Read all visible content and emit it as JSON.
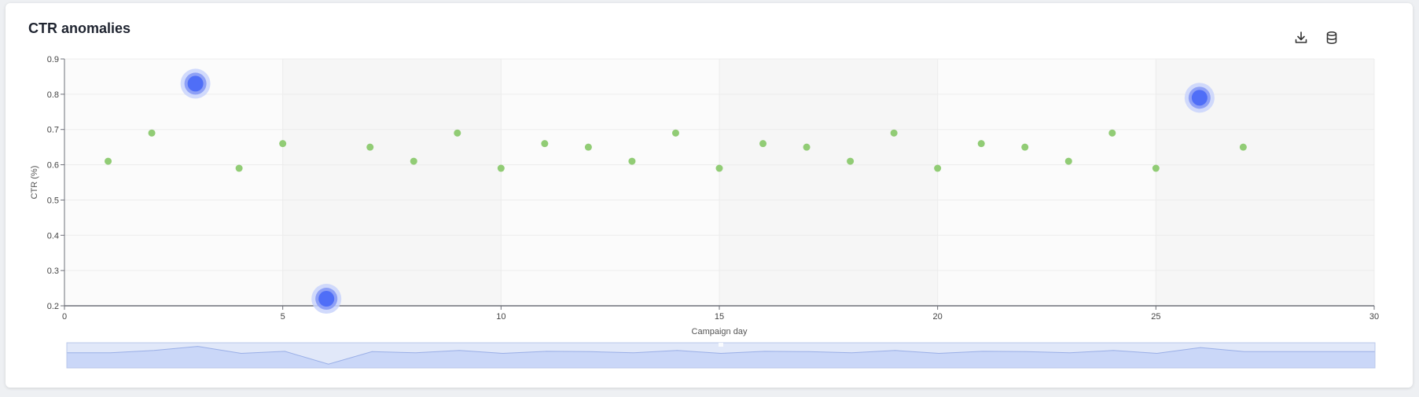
{
  "card": {
    "title": "CTR anomalies",
    "toolbar": {
      "download_icon": "download-icon",
      "data_view_icon": "database-icon"
    }
  },
  "chart_data": {
    "type": "scatter",
    "title": "CTR anomalies",
    "xlabel": "Campaign day",
    "ylabel": "CTR (%)",
    "xlim": [
      0,
      30
    ],
    "ylim": [
      0.2,
      0.9
    ],
    "xticks": [
      0,
      5,
      10,
      15,
      20,
      25,
      30
    ],
    "yticks": [
      0.2,
      0.3,
      0.4,
      0.5,
      0.6,
      0.7,
      0.8,
      0.9
    ],
    "grid": true,
    "points": [
      {
        "x": 1,
        "y": 0.61,
        "anomaly": false
      },
      {
        "x": 2,
        "y": 0.69,
        "anomaly": false
      },
      {
        "x": 3,
        "y": 0.83,
        "anomaly": true
      },
      {
        "x": 4,
        "y": 0.59,
        "anomaly": false
      },
      {
        "x": 5,
        "y": 0.66,
        "anomaly": false
      },
      {
        "x": 6,
        "y": 0.22,
        "anomaly": true
      },
      {
        "x": 7,
        "y": 0.65,
        "anomaly": false
      },
      {
        "x": 8,
        "y": 0.61,
        "anomaly": false
      },
      {
        "x": 9,
        "y": 0.69,
        "anomaly": false
      },
      {
        "x": 10,
        "y": 0.59,
        "anomaly": false
      },
      {
        "x": 11,
        "y": 0.66,
        "anomaly": false
      },
      {
        "x": 12,
        "y": 0.65,
        "anomaly": false
      },
      {
        "x": 13,
        "y": 0.61,
        "anomaly": false
      },
      {
        "x": 14,
        "y": 0.69,
        "anomaly": false
      },
      {
        "x": 15,
        "y": 0.59,
        "anomaly": false
      },
      {
        "x": 16,
        "y": 0.66,
        "anomaly": false
      },
      {
        "x": 17,
        "y": 0.65,
        "anomaly": false
      },
      {
        "x": 18,
        "y": 0.61,
        "anomaly": false
      },
      {
        "x": 19,
        "y": 0.69,
        "anomaly": false
      },
      {
        "x": 20,
        "y": 0.59,
        "anomaly": false
      },
      {
        "x": 21,
        "y": 0.66,
        "anomaly": false
      },
      {
        "x": 22,
        "y": 0.65,
        "anomaly": false
      },
      {
        "x": 23,
        "y": 0.61,
        "anomaly": false
      },
      {
        "x": 24,
        "y": 0.69,
        "anomaly": false
      },
      {
        "x": 25,
        "y": 0.59,
        "anomaly": false
      },
      {
        "x": 26,
        "y": 0.79,
        "anomaly": true
      },
      {
        "x": 27,
        "y": 0.65,
        "anomaly": false
      }
    ],
    "colors": {
      "normal": "#91cc75",
      "anomaly": "#4f6ef7",
      "anomaly_halo": "#c9d3fb",
      "zoom_fill": "#d4defa",
      "zoom_line": "#9eb1e6"
    },
    "datazoom": {
      "start": 0,
      "end": 100
    }
  }
}
